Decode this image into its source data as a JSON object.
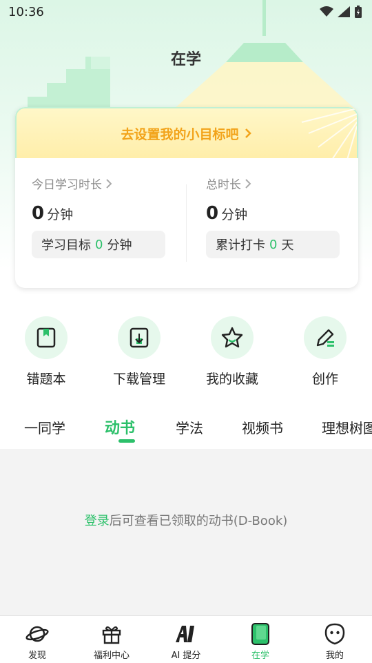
{
  "status_bar": {
    "time": "10:36"
  },
  "page": {
    "title": "在学"
  },
  "goal_card": {
    "banner": "去设置我的小目标吧",
    "today": {
      "label": "今日学习时长",
      "value": "0",
      "unit": "分钟",
      "pill_prefix": "学习目标",
      "pill_value": "0",
      "pill_suffix": "分钟"
    },
    "total": {
      "label": "总时长",
      "value": "0",
      "unit": "分钟",
      "pill_prefix": "累计打卡",
      "pill_value": "0",
      "pill_suffix": "天"
    }
  },
  "quick_actions": [
    {
      "label": "错题本",
      "icon": "bookmark-book-icon"
    },
    {
      "label": "下载管理",
      "icon": "download-icon"
    },
    {
      "label": "我的收藏",
      "icon": "star-icon"
    },
    {
      "label": "创作",
      "icon": "edit-pen-icon"
    }
  ],
  "tabs": [
    {
      "label": "一同学",
      "active": false
    },
    {
      "label": "动书",
      "active": true
    },
    {
      "label": "学法",
      "active": false
    },
    {
      "label": "视频书",
      "active": false
    },
    {
      "label": "理想树图",
      "active": false
    }
  ],
  "empty_state": {
    "login_link": "登录",
    "message": "后可查看已领取的动书(D-Book)"
  },
  "bottom_nav": [
    {
      "label": "发现",
      "icon": "planet-icon",
      "active": false
    },
    {
      "label": "福利中心",
      "icon": "gift-icon",
      "active": false
    },
    {
      "label": "AI 提分",
      "icon": "ai-icon",
      "active": false
    },
    {
      "label": "在学",
      "icon": "book-icon",
      "active": true
    },
    {
      "label": "我的",
      "icon": "face-icon",
      "active": false
    }
  ],
  "colors": {
    "accent": "#2cc06a",
    "banner_text": "#f2a31a"
  }
}
